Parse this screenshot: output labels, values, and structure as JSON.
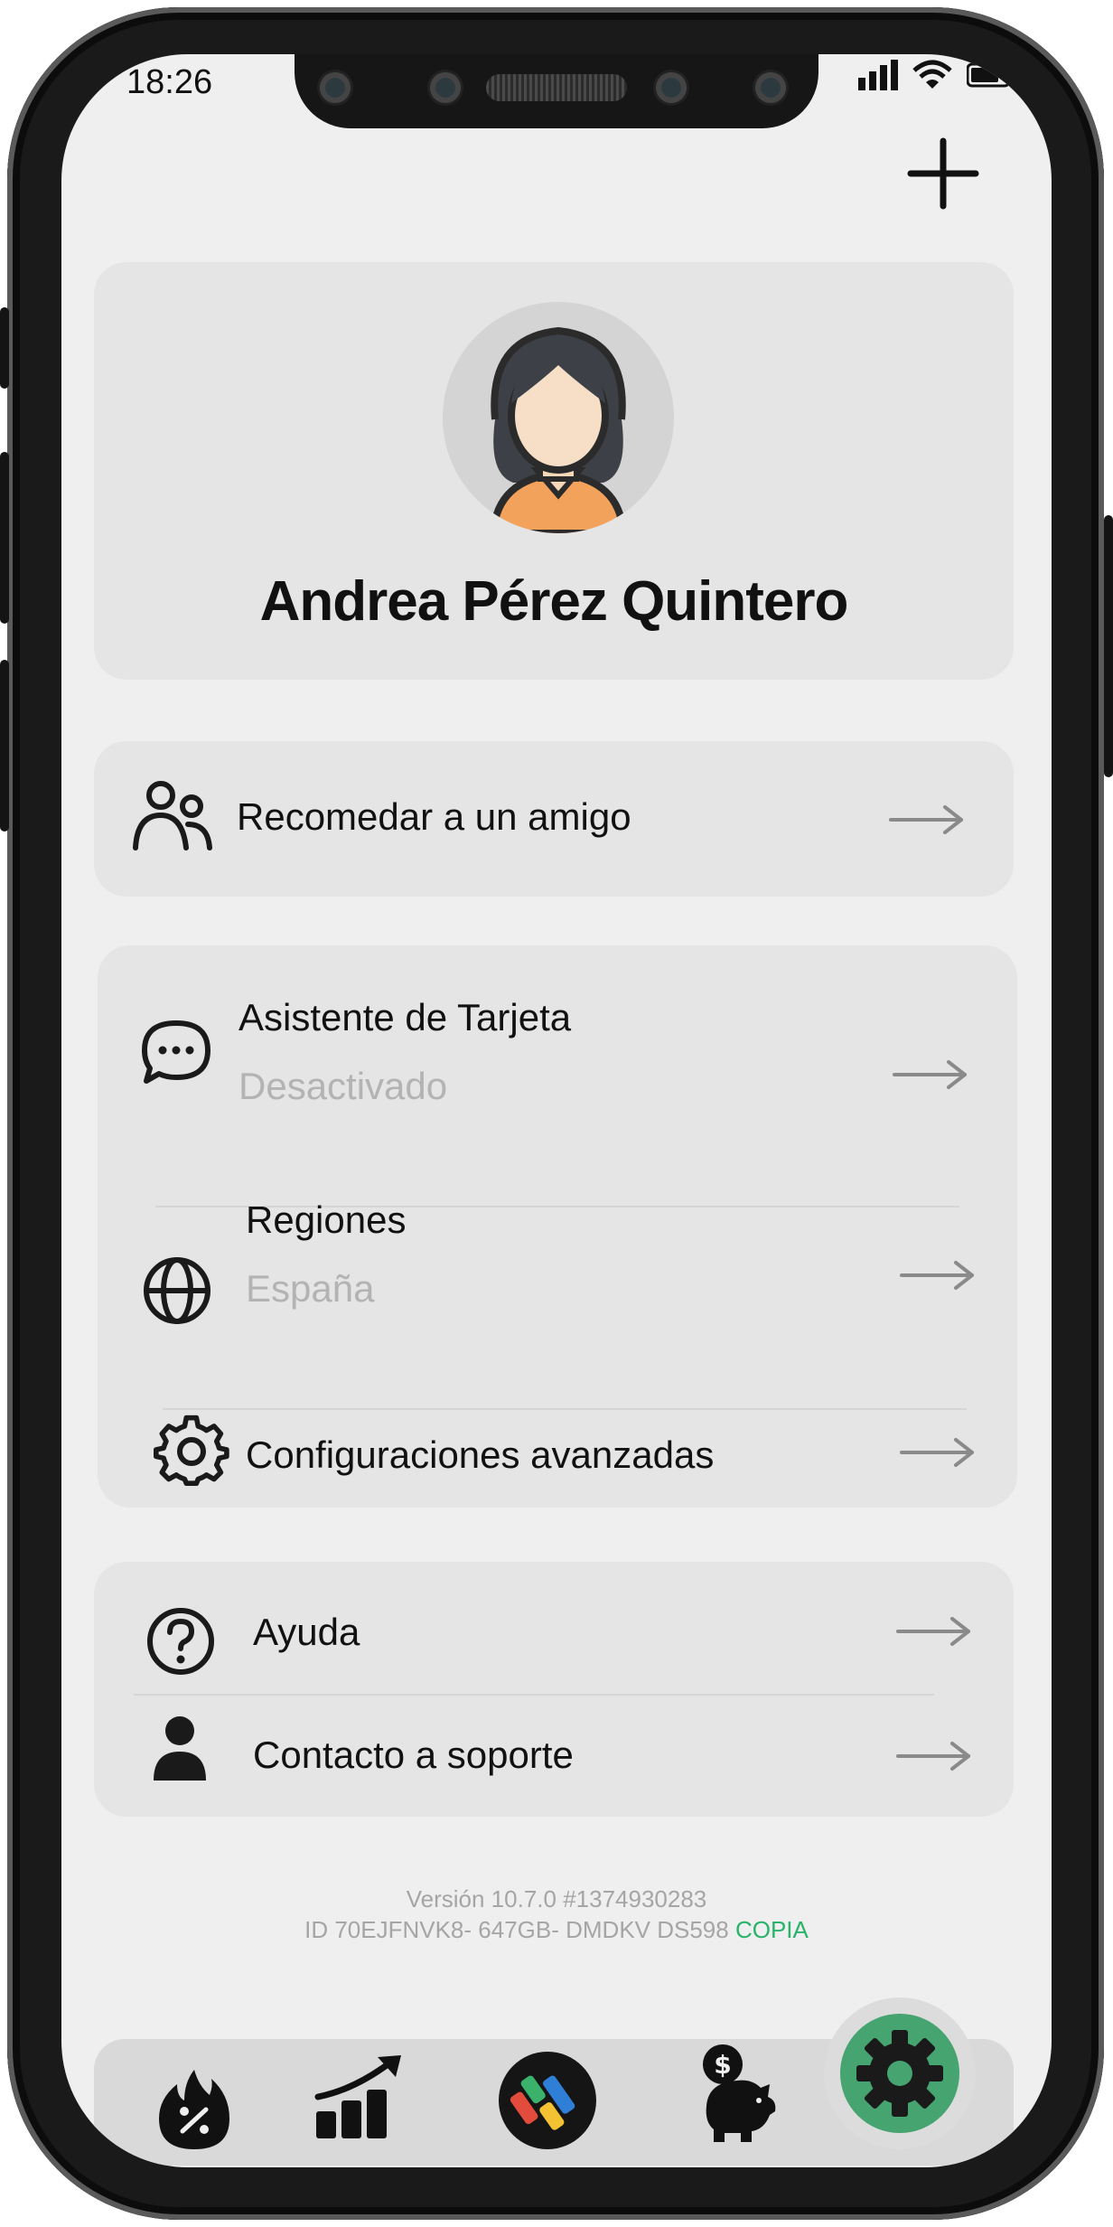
{
  "status_bar": {
    "time": "18:26"
  },
  "header": {
    "add_icon": "plus-icon"
  },
  "profile": {
    "name": "Andrea Pérez Quintero"
  },
  "referral": {
    "label": "Recomedar a un amigo",
    "icon": "users-icon"
  },
  "settings_group": [
    {
      "title": "Asistente de Tarjeta",
      "subtitle": "Desactivado",
      "icon": "chat-bubble-icon"
    },
    {
      "title": "Regiones",
      "subtitle": "España",
      "icon": "globe-icon"
    },
    {
      "title": "Configuraciones avanzadas",
      "icon": "gear-icon"
    }
  ],
  "help_group": [
    {
      "title": "Ayuda",
      "icon": "question-circle-icon"
    },
    {
      "title": "Contacto a soporte",
      "icon": "user-icon"
    }
  ],
  "footer": {
    "version": "Versión 10.7.0 #1374930283",
    "id_text": "ID 70EJFNVK8- 647GB- DMDKV DS598",
    "copy_label": "COPIA"
  },
  "nav": [
    {
      "name": "offers",
      "icon": "flame-percent-icon"
    },
    {
      "name": "stats",
      "icon": "growth-chart-icon"
    },
    {
      "name": "home",
      "icon": "app-logo-icon"
    },
    {
      "name": "savings",
      "icon": "piggy-bank-icon"
    },
    {
      "name": "settings",
      "icon": "gear-icon",
      "active": true
    }
  ],
  "colors": {
    "accent": "#29b36a",
    "active_nav": "#45a46f",
    "card": "#e5e5e5",
    "muted_text": "#b3b3b3"
  }
}
